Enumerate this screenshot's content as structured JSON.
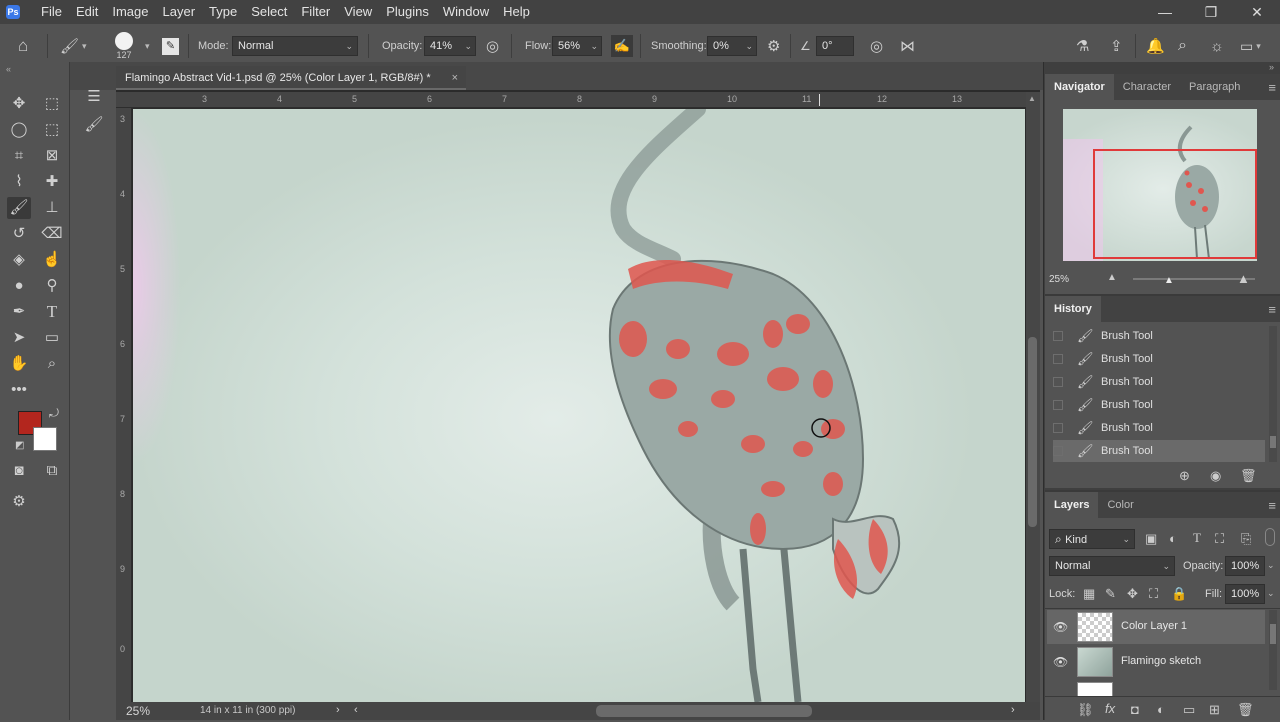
{
  "menubar": {
    "items": [
      "File",
      "Edit",
      "Image",
      "Layer",
      "Type",
      "Select",
      "Filter",
      "View",
      "Plugins",
      "Window",
      "Help"
    ],
    "window_controls": [
      "—",
      "❐",
      "✕"
    ]
  },
  "options": {
    "brush_size": "127",
    "mode_label": "Mode:",
    "mode_value": "Normal",
    "opacity_label": "Opacity:",
    "opacity_value": "41%",
    "flow_label": "Flow:",
    "flow_value": "56%",
    "smoothing_label": "Smoothing:",
    "smoothing_value": "0%",
    "angle_value": "0°"
  },
  "document": {
    "tab_title": "Flamingo Abstract Vid-1.psd @ 25% (Color Layer 1, RGB/8#) *",
    "close": "×",
    "zoom": "25%",
    "doc_info": "14 in x 11 in (300 ppi)",
    "h_ruler_labels": [
      "3",
      "4",
      "5",
      "6",
      "7",
      "8",
      "9",
      "10",
      "11",
      "12",
      "13"
    ],
    "v_ruler_labels": [
      "3",
      "4",
      "5",
      "6",
      "7",
      "8",
      "9",
      "0"
    ]
  },
  "toolbar": {
    "foreground_color": "#b3261e",
    "background_color": "#ffffff"
  },
  "navigator": {
    "tabs": [
      "Navigator",
      "Character",
      "Paragraph"
    ],
    "zoom": "25%"
  },
  "history": {
    "title": "History",
    "items": [
      "Brush Tool",
      "Brush Tool",
      "Brush Tool",
      "Brush Tool",
      "Brush Tool",
      "Brush Tool"
    ]
  },
  "layers": {
    "tabs": [
      "Layers",
      "Color"
    ],
    "filter_kind": "Kind",
    "blend_mode": "Normal",
    "opacity_label": "Opacity:",
    "opacity_value": "100%",
    "lock_label": "Lock:",
    "fill_label": "Fill:",
    "fill_value": "100%",
    "items": [
      {
        "name": "Color Layer 1"
      },
      {
        "name": "Flamingo sketch"
      }
    ]
  },
  "colors": {
    "accent_red": "#e0574f",
    "nav_box": "#e03a3a"
  }
}
